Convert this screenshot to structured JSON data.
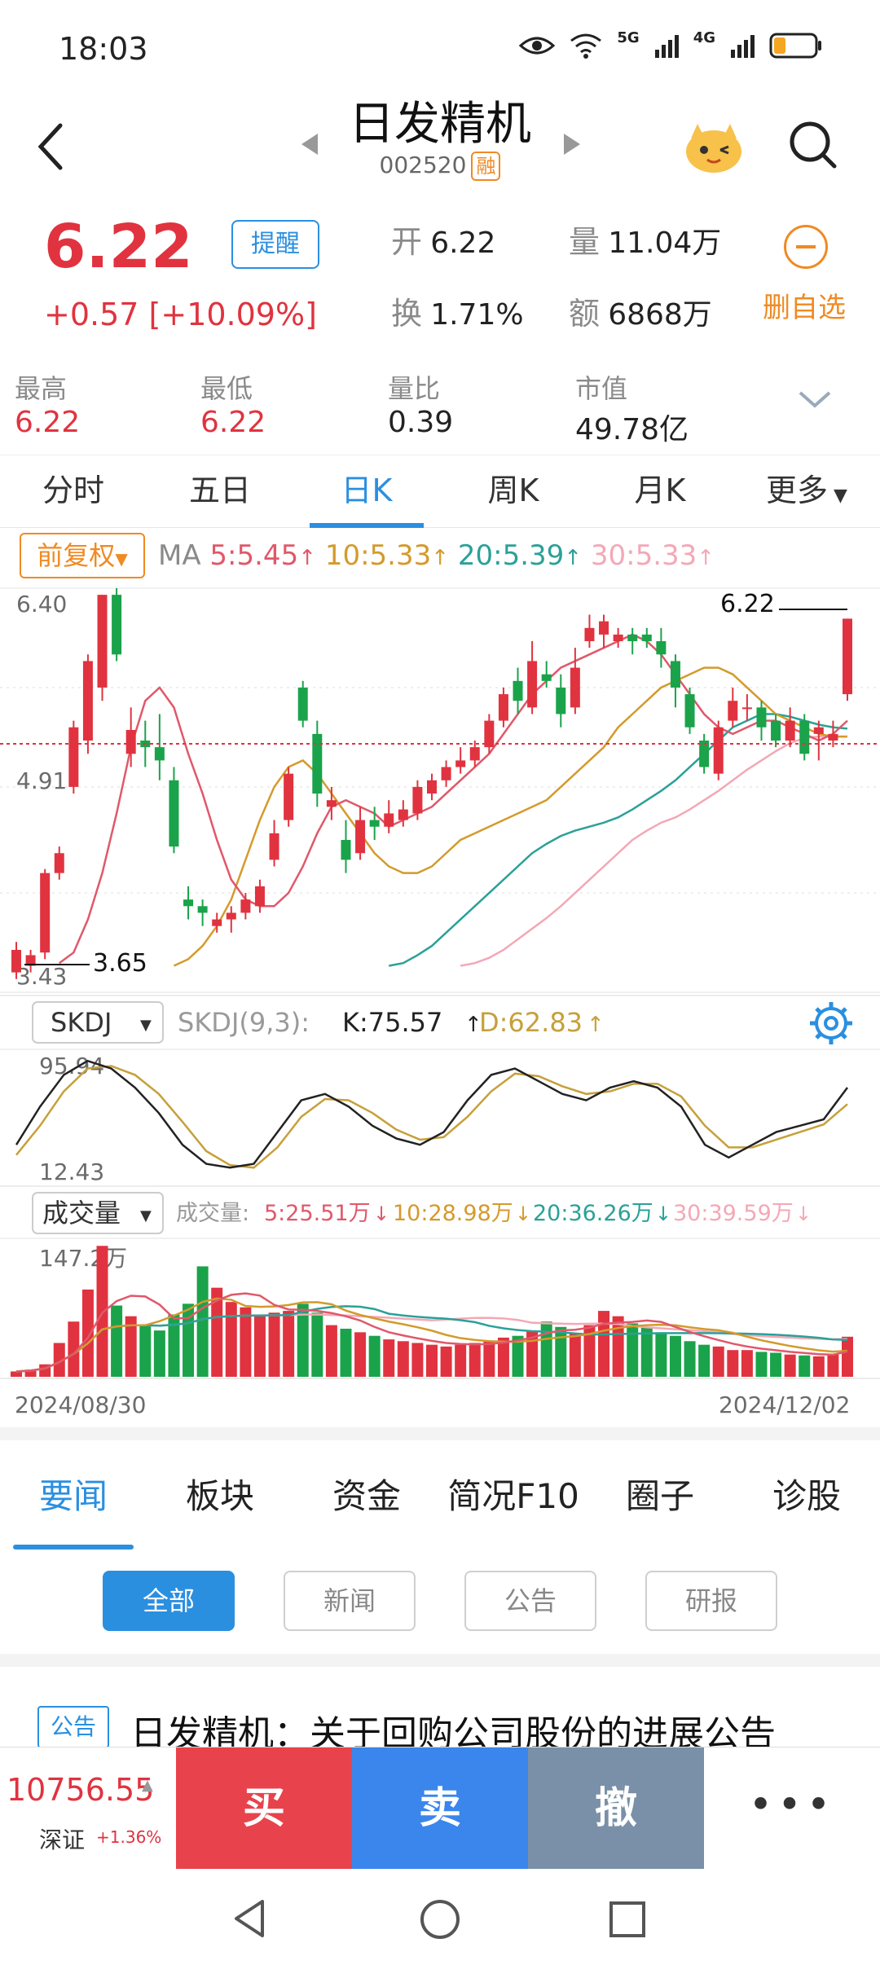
{
  "status_bar": {
    "time": "18:03",
    "net1": "5G",
    "net2": "4G"
  },
  "header": {
    "stock_name": "日发精机",
    "stock_code": "002520",
    "margin_badge": "融"
  },
  "quote": {
    "price": "6.22",
    "remind_label": "提醒",
    "change": "+0.57  [+10.09%]",
    "open_label": "开",
    "open_value": "6.22",
    "volume_label": "量",
    "volume_value": "11.04万",
    "turnover_label": "换",
    "turnover_value": "1.71%",
    "amount_label": "额",
    "amount_value": "6868万",
    "delete_label": "删自选"
  },
  "stats": [
    {
      "label": "最高",
      "value": "6.22",
      "color": "#e0333f"
    },
    {
      "label": "最低",
      "value": "6.22",
      "color": "#e0333f"
    },
    {
      "label": "量比",
      "value": "0.39",
      "color": "#222222"
    },
    {
      "label": "市值",
      "value": "49.78亿",
      "color": "#222222"
    }
  ],
  "period_tabs": [
    "分时",
    "五日",
    "日K",
    "周K",
    "月K",
    "更多"
  ],
  "active_period": "日K",
  "ma_bar": {
    "adjust_label": "前复权",
    "ma_label": "MA",
    "ma5": "5:5.45",
    "ma10": "10:5.33",
    "ma20": "20:5.39",
    "ma30": "30:5.33",
    "colors": {
      "ma5": "#e0586a",
      "ma10": "#d49a2c",
      "ma20": "#2aa198",
      "ma30": "#f3a8b6",
      "up": "#e0333f",
      "down": "#1aa34a"
    }
  },
  "price_axis": {
    "top": "6.40",
    "mid": "4.91",
    "bottom": "3.43",
    "last_marker": "6.22",
    "low_marker": "3.65"
  },
  "skdj": {
    "selector": "SKDJ",
    "params": "SKDJ(9,3):",
    "k": "K:75.57",
    "d": "D:62.83",
    "top": "95.94",
    "bottom": "12.43"
  },
  "volume_panel": {
    "selector": "成交量",
    "label": "成交量:",
    "ma5": "5:25.51万",
    "ma10": "10:28.98万",
    "ma20": "20:36.26万",
    "ma30": "30:39.59万",
    "max": "147.2万"
  },
  "date_range": {
    "start": "2024/08/30",
    "end": "2024/12/02"
  },
  "chart_data": {
    "type": "candlestick",
    "candles": [
      [
        3.55,
        3.72,
        3.5,
        3.78
      ],
      [
        3.6,
        3.68,
        3.55,
        3.72
      ],
      [
        3.7,
        4.3,
        3.65,
        4.33
      ],
      [
        4.3,
        4.45,
        4.25,
        4.5
      ],
      [
        4.95,
        5.4,
        4.9,
        5.45
      ],
      [
        5.3,
        5.9,
        5.2,
        5.95
      ],
      [
        5.7,
        6.4,
        5.6,
        6.4
      ],
      [
        6.4,
        5.95,
        5.9,
        6.45
      ],
      [
        5.2,
        5.38,
        5.1,
        5.55
      ],
      [
        5.3,
        5.25,
        5.1,
        5.45
      ],
      [
        5.25,
        5.15,
        5.0,
        5.5
      ],
      [
        5.0,
        4.5,
        4.45,
        5.1
      ],
      [
        4.1,
        4.05,
        3.95,
        4.2
      ],
      [
        4.05,
        4.0,
        3.9,
        4.1
      ],
      [
        3.9,
        3.95,
        3.85,
        4.0
      ],
      [
        3.95,
        4.0,
        3.85,
        4.05
      ],
      [
        4.0,
        4.1,
        3.95,
        4.15
      ],
      [
        4.05,
        4.2,
        4.0,
        4.25
      ],
      [
        4.4,
        4.6,
        4.35,
        4.7
      ],
      [
        4.7,
        5.05,
        4.65,
        5.1
      ],
      [
        5.7,
        5.45,
        5.4,
        5.75
      ],
      [
        5.35,
        4.9,
        4.8,
        5.45
      ],
      [
        4.8,
        4.85,
        4.7,
        4.95
      ],
      [
        4.55,
        4.4,
        4.3,
        4.7
      ],
      [
        4.45,
        4.7,
        4.4,
        4.8
      ],
      [
        4.7,
        4.65,
        4.55,
        4.8
      ],
      [
        4.65,
        4.75,
        4.6,
        4.85
      ],
      [
        4.7,
        4.78,
        4.65,
        4.85
      ],
      [
        4.75,
        4.95,
        4.7,
        5.0
      ],
      [
        4.9,
        5.0,
        4.85,
        5.05
      ],
      [
        5.0,
        5.1,
        4.95,
        5.15
      ],
      [
        5.1,
        5.15,
        5.05,
        5.25
      ],
      [
        5.15,
        5.25,
        5.1,
        5.3
      ],
      [
        5.25,
        5.45,
        5.2,
        5.5
      ],
      [
        5.45,
        5.65,
        5.4,
        5.7
      ],
      [
        5.75,
        5.6,
        5.5,
        5.85
      ],
      [
        5.55,
        5.9,
        5.5,
        6.05
      ],
      [
        5.8,
        5.75,
        5.7,
        5.9
      ],
      [
        5.7,
        5.5,
        5.4,
        5.8
      ],
      [
        5.55,
        5.85,
        5.5,
        6.0
      ],
      [
        6.05,
        6.15,
        6.0,
        6.25
      ],
      [
        6.1,
        6.2,
        6.0,
        6.25
      ],
      [
        6.05,
        6.1,
        6.0,
        6.15
      ],
      [
        6.1,
        6.05,
        5.95,
        6.15
      ],
      [
        6.1,
        6.05,
        6.0,
        6.15
      ],
      [
        6.05,
        5.95,
        5.85,
        6.15
      ],
      [
        5.9,
        5.7,
        5.55,
        5.95
      ],
      [
        5.65,
        5.4,
        5.35,
        5.7
      ],
      [
        5.3,
        5.1,
        5.05,
        5.35
      ],
      [
        5.05,
        5.4,
        5.0,
        5.45
      ],
      [
        5.45,
        5.6,
        5.4,
        5.7
      ],
      [
        5.55,
        5.55,
        5.45,
        5.65
      ],
      [
        5.55,
        5.4,
        5.3,
        5.6
      ],
      [
        5.45,
        5.3,
        5.25,
        5.5
      ],
      [
        5.3,
        5.45,
        5.25,
        5.55
      ],
      [
        5.45,
        5.2,
        5.15,
        5.5
      ],
      [
        5.35,
        5.4,
        5.15,
        5.45
      ],
      [
        5.3,
        5.35,
        5.25,
        5.45
      ],
      [
        5.65,
        6.22,
        5.6,
        6.22
      ]
    ],
    "volume": [
      6,
      8,
      14,
      38,
      62,
      98,
      147,
      80,
      68,
      58,
      52,
      70,
      82,
      124,
      100,
      84,
      78,
      70,
      72,
      74,
      82,
      72,
      58,
      54,
      50,
      46,
      42,
      40,
      38,
      36,
      34,
      36,
      38,
      40,
      44,
      46,
      52,
      62,
      56,
      48,
      58,
      74,
      68,
      60,
      56,
      50,
      46,
      40,
      36,
      34,
      30,
      30,
      28,
      27,
      25,
      24,
      23,
      25,
      45,
      26
    ],
    "ma5": [
      3.62,
      3.7,
      3.95,
      4.3,
      4.75,
      5.25,
      5.6,
      5.7,
      5.55,
      5.2,
      4.9,
      4.55,
      4.25,
      4.1,
      4.05,
      4.05,
      4.15,
      4.35,
      4.6,
      4.8,
      4.85,
      4.8,
      4.75,
      4.65,
      4.7,
      4.75,
      4.8,
      4.9,
      5.0,
      5.1,
      5.2,
      5.35,
      5.5,
      5.65,
      5.75,
      5.85,
      5.9,
      5.95,
      6.0,
      6.05,
      6.1,
      6.05,
      5.95,
      5.8,
      5.65,
      5.5,
      5.4,
      5.35,
      5.4,
      5.45,
      5.45,
      5.4,
      5.35,
      5.3,
      5.35,
      5.45
    ],
    "ma10": [
      3.6,
      3.65,
      3.75,
      3.9,
      4.1,
      4.4,
      4.7,
      4.95,
      5.1,
      5.15,
      5.05,
      4.9,
      4.75,
      4.6,
      4.45,
      4.35,
      4.3,
      4.3,
      4.35,
      4.45,
      4.55,
      4.6,
      4.65,
      4.7,
      4.75,
      4.8,
      4.85,
      4.95,
      5.05,
      5.15,
      5.25,
      5.4,
      5.5,
      5.6,
      5.7,
      5.75,
      5.8,
      5.85,
      5.85,
      5.8,
      5.7,
      5.6,
      5.5,
      5.45,
      5.4,
      5.35,
      5.33,
      5.33
    ],
    "ma20": [
      3.6,
      3.62,
      3.68,
      3.75,
      3.85,
      3.95,
      4.05,
      4.15,
      4.25,
      4.35,
      4.45,
      4.52,
      4.58,
      4.62,
      4.65,
      4.68,
      4.72,
      4.78,
      4.85,
      4.92,
      5.0,
      5.1,
      5.2,
      5.3,
      5.4,
      5.45,
      5.5,
      5.5,
      5.48,
      5.45,
      5.42,
      5.4,
      5.39
    ],
    "ma30": [
      3.6,
      3.62,
      3.66,
      3.72,
      3.8,
      3.88,
      3.96,
      4.05,
      4.15,
      4.25,
      4.35,
      4.45,
      4.55,
      4.62,
      4.68,
      4.72,
      4.78,
      4.85,
      4.92,
      5.0,
      5.08,
      5.15,
      5.22,
      5.28,
      5.32,
      5.33,
      5.33,
      5.33
    ],
    "skdj_k": [
      30,
      60,
      85,
      96,
      90,
      75,
      55,
      30,
      15,
      12,
      15,
      40,
      65,
      70,
      60,
      45,
      35,
      30,
      40,
      65,
      85,
      90,
      80,
      70,
      65,
      75,
      80,
      75,
      60,
      30,
      20,
      30,
      40,
      45,
      50,
      75
    ],
    "skdj_d": [
      22,
      45,
      72,
      90,
      92,
      85,
      70,
      48,
      25,
      14,
      12,
      28,
      52,
      66,
      65,
      55,
      42,
      34,
      36,
      52,
      72,
      86,
      84,
      76,
      70,
      72,
      78,
      78,
      68,
      45,
      28,
      28,
      34,
      40,
      46,
      62
    ]
  },
  "info_tabs": [
    "要闻",
    "板块",
    "资金",
    "简况F10",
    "圈子",
    "诊股"
  ],
  "active_info_tab": "要闻",
  "filters": [
    "全部",
    "新闻",
    "公告",
    "研报"
  ],
  "news": {
    "tag": "公告",
    "title": "日发精机：关于回购公司股份的进展公告"
  },
  "trade_bar": {
    "index_value": "10756.55",
    "index_name": "深证",
    "index_pct": "+1.36%",
    "buy": "买",
    "sell": "卖",
    "cancel": "撤",
    "more": "•••"
  }
}
